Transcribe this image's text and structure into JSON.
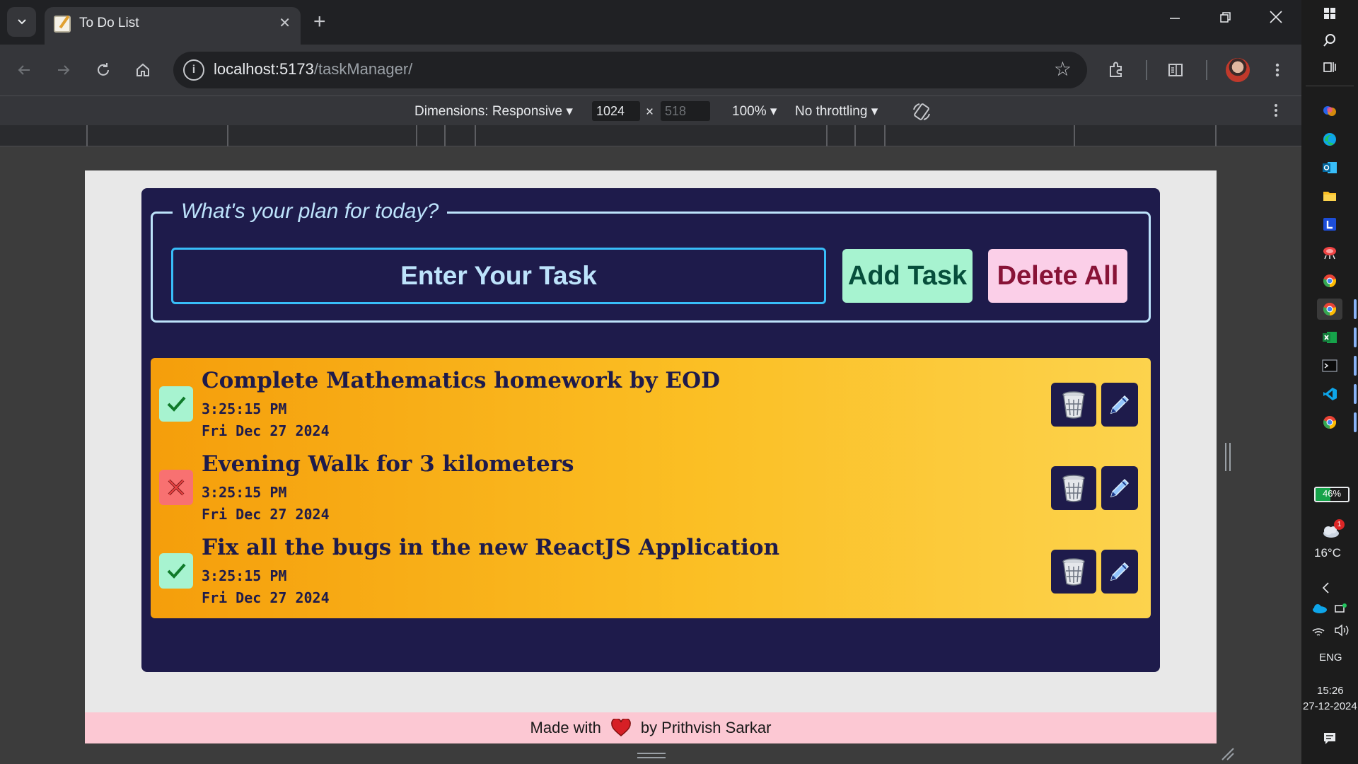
{
  "browser": {
    "tab_title": "To Do List",
    "url_host": "localhost:5173",
    "url_path": "/taskManager/"
  },
  "devtools": {
    "dimensions_label": "Dimensions: Responsive",
    "width": "1024",
    "x_sep": "×",
    "height_placeholder": "518",
    "zoom": "100%",
    "throttling": "No throttling"
  },
  "app": {
    "legend": "What's your plan for today?",
    "input_placeholder": "Enter Your Task",
    "add_button": "Add Task",
    "delete_all_button": "Delete All",
    "tasks": [
      {
        "title": "Complete Mathematics homework by EOD",
        "time": "3:25:15 PM",
        "date": "Fri Dec 27 2024",
        "status": "done"
      },
      {
        "title": "Evening Walk for 3 kilometers",
        "time": "3:25:15 PM",
        "date": "Fri Dec 27 2024",
        "status": "not-done"
      },
      {
        "title": "Fix all the bugs in the new ReactJS Application",
        "time": "3:25:15 PM",
        "date": "Fri Dec 27 2024",
        "status": "done"
      }
    ],
    "footer_prefix": "Made with",
    "footer_suffix": "by Prithvish Sarkar",
    "colors": {
      "card_bg": "#1e1b4b",
      "task_gradient_start": "#f59e0b",
      "task_gradient_end": "#fcd34d",
      "add_bg": "#a7f3d0",
      "delete_bg": "#fbcfe8",
      "footer_bg": "#fcc8d3"
    }
  },
  "taskbar": {
    "battery": "46%",
    "temperature": "16°C",
    "weather_badge": "1",
    "language": "ENG",
    "time": "15:26",
    "date": "27-12-2024"
  }
}
